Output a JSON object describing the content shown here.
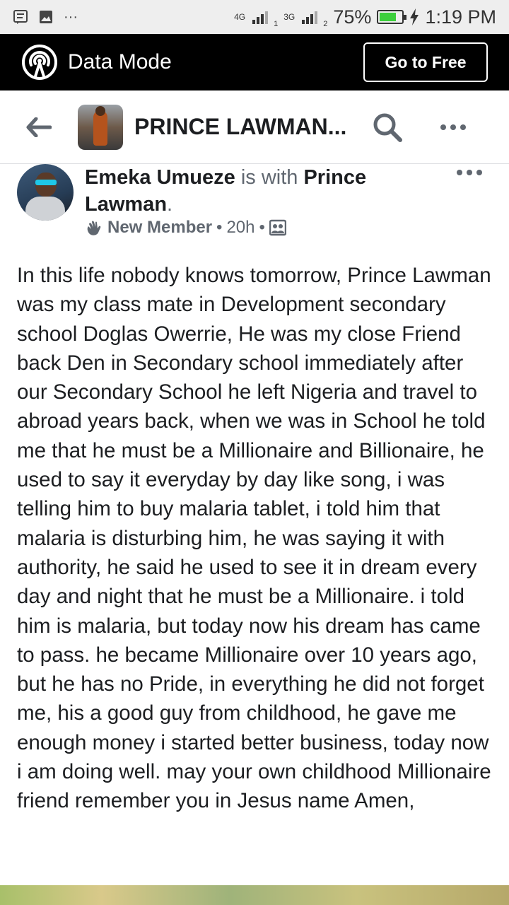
{
  "status_bar": {
    "network1": "4G",
    "sim1": "1",
    "network2": "3G",
    "sim2": "2",
    "battery_percent": "75%",
    "battery_level": 0.75,
    "time": "1:19 PM",
    "icons": [
      "message-icon",
      "image-icon",
      "more-notifications-icon",
      "signal-icon",
      "battery-icon",
      "charging-icon"
    ]
  },
  "data_bar": {
    "title": "Data Mode",
    "button_label": "Go to Free",
    "icon": "broadcast-icon"
  },
  "header": {
    "title": "PRINCE LAWMAN...",
    "icons": [
      "back-arrow-icon",
      "search-icon",
      "more-icon"
    ]
  },
  "post": {
    "author": "Emeka Umueze",
    "with_text": " is with ",
    "tagged": "Prince Lawman",
    "period": ".",
    "badge": "New Member",
    "time": "20h",
    "separator": "•",
    "audience_icon": "group-audience-icon",
    "body": "In this life nobody knows tomorrow, Prince Lawman was my class mate in Development secondary school Doglas Owerrie, He was my close Friend back Den in Secondary school immediately after our Secondary School he left Nigeria and travel to abroad years back, when we was in School he told me that he must be a Millionaire and Billionaire, he used to say it everyday by day like song, i was telling him to buy malaria tablet, i told him that malaria is disturbing him, he was saying it with authority, he said he used to see it in dream every day and night that he must be a Millionaire. i told him is malaria, but today now his dream has came to pass. he became Millionaire over 10 years ago, but he has no Pride, in everything he did not forget me, his a good guy from childhood, he gave me enough money i started better business, today now i am doing well. may your own childhood Millionaire friend remember you in Jesus name Amen,"
  }
}
